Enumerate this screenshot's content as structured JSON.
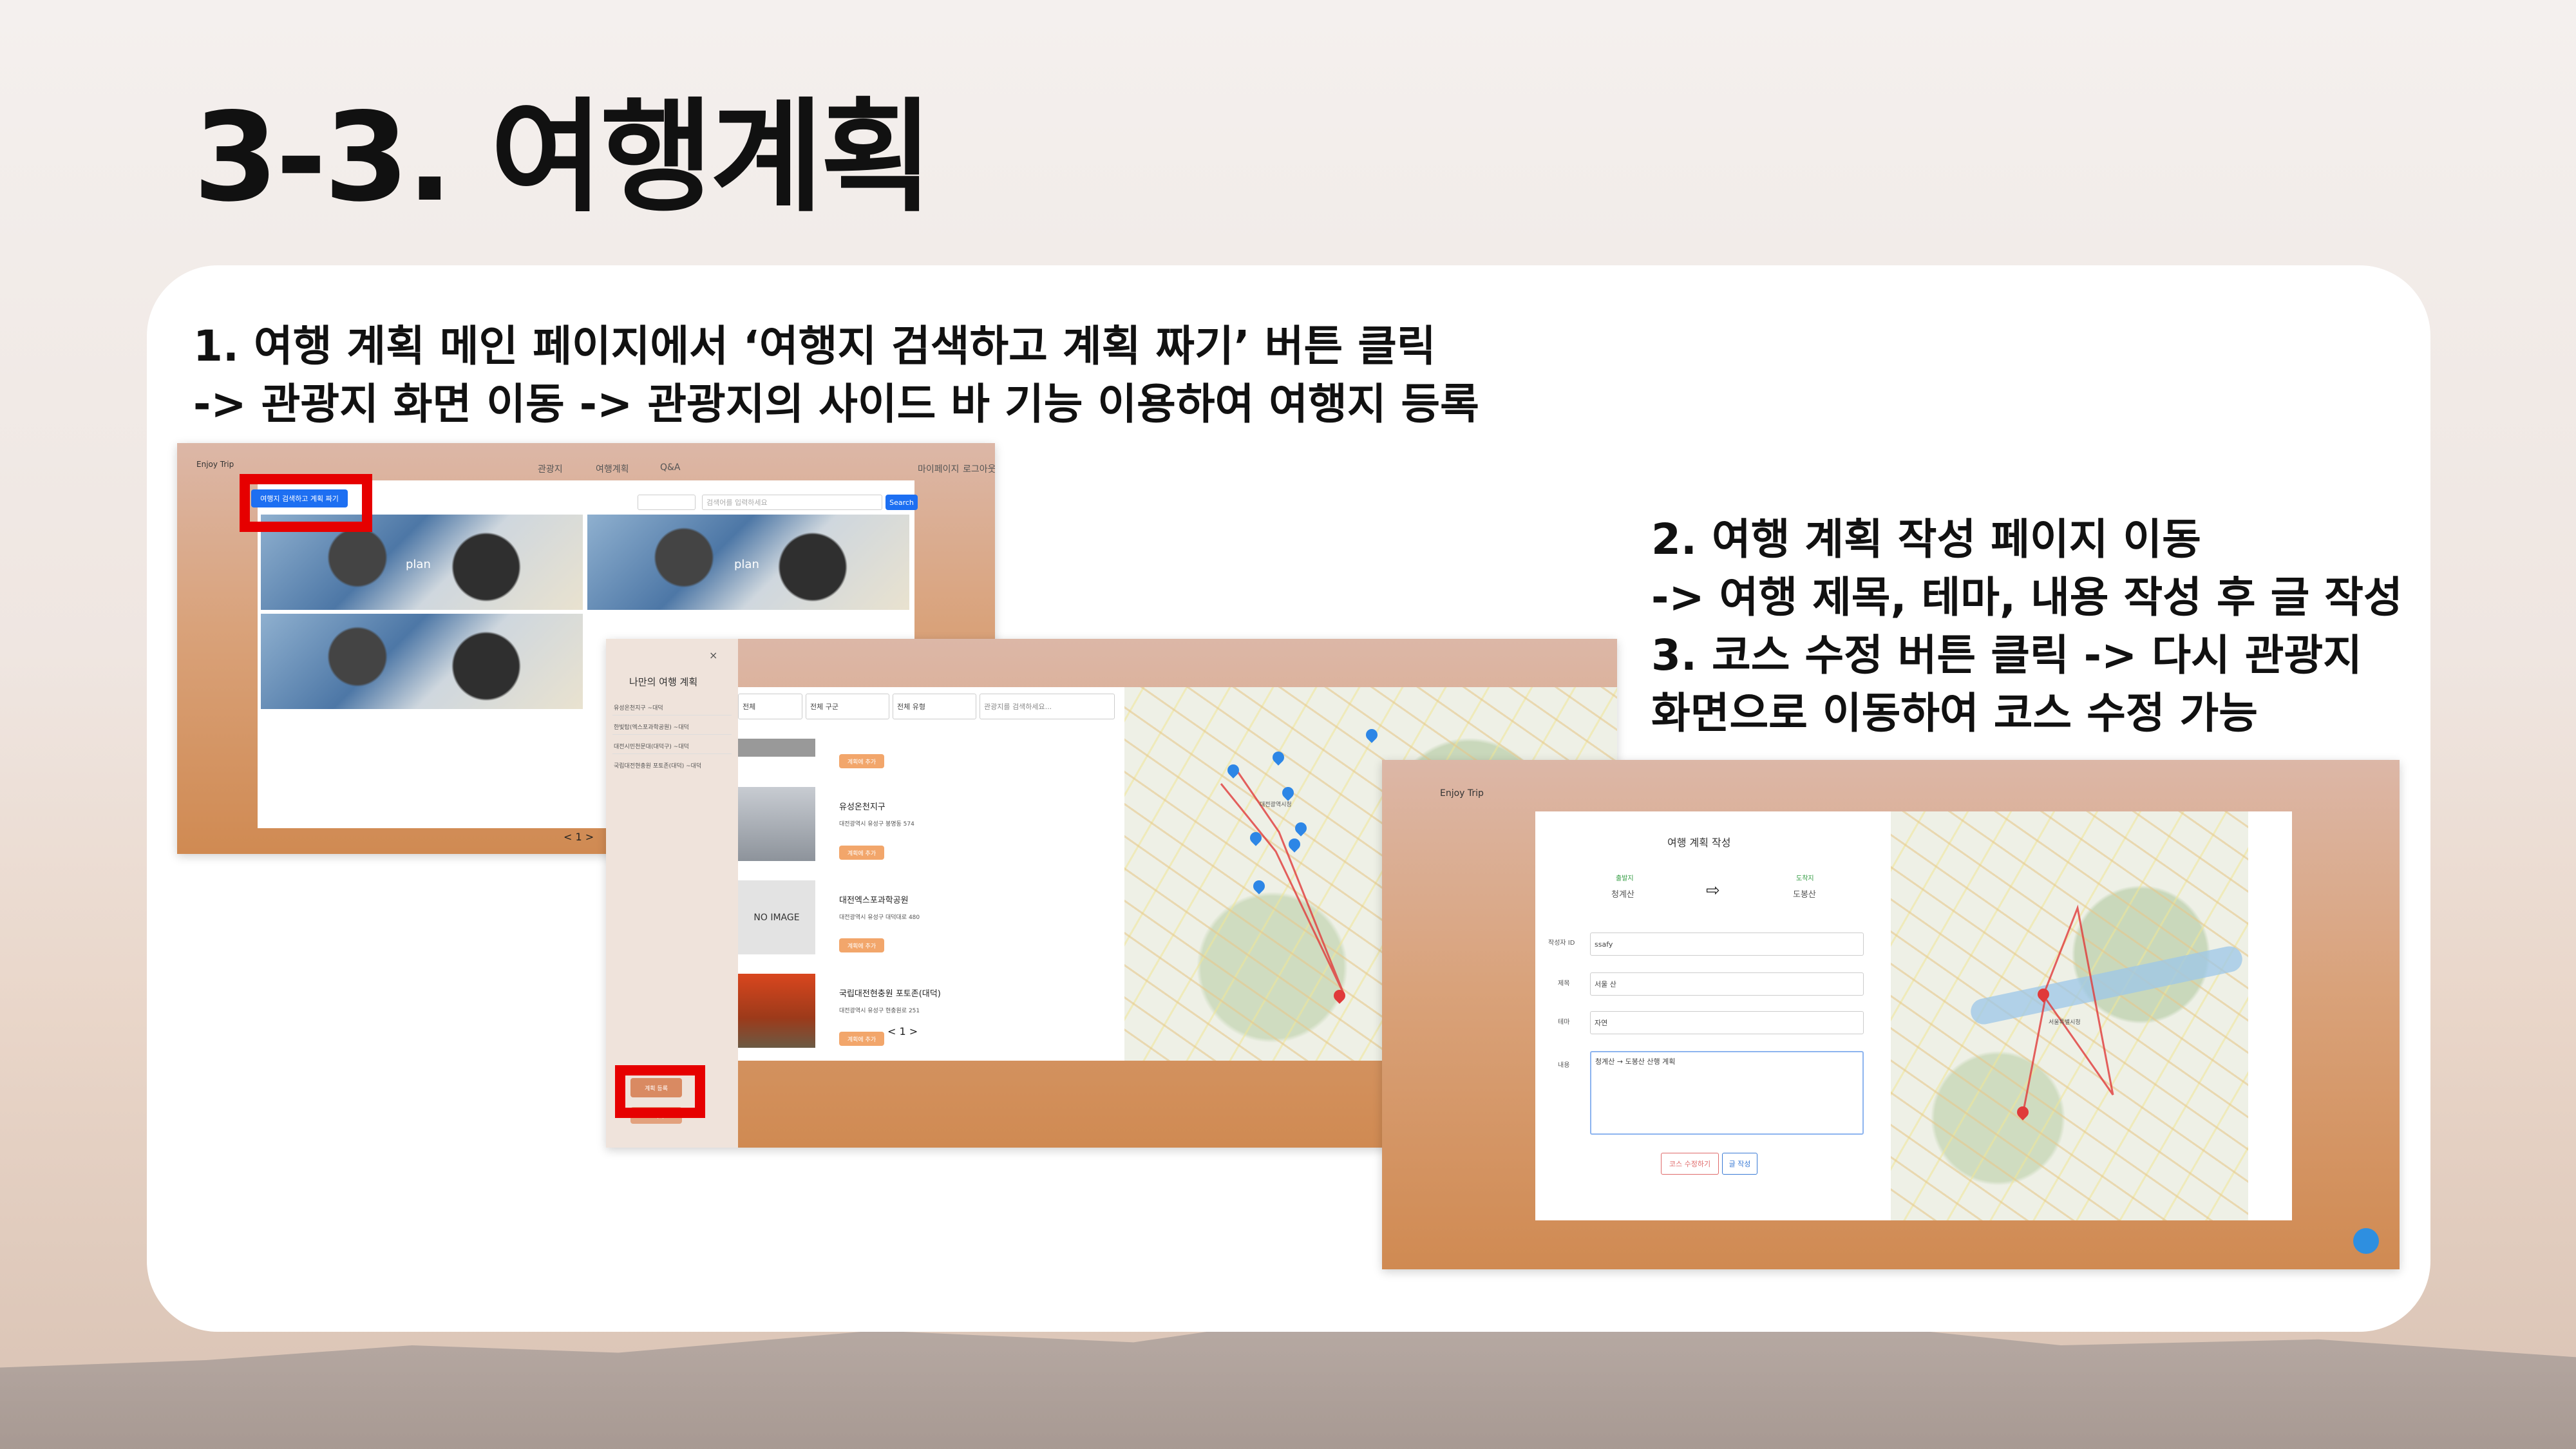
{
  "slide": {
    "title": "3-3. 여행계획",
    "step1_line1": "1. 여행 계획 메인 페이지에서 ‘여행지 검색하고 계획 짜기’ 버튼 클릭",
    "step1_line2": "-> 관광지 화면 이동 -> 관광지의 사이드 바 기능 이용하여 여행지 등록",
    "step2_line1": "2. 여행 계획 작성 페이지 이동",
    "step2_line2": "-> 여행 제목, 테마, 내용 작성 후 글 작성",
    "step3_line1": "3. 코스 수정 버튼 클릭 -> 다시 관광지",
    "step3_line2": "화면으로 이동하여 코스 수정 가능"
  },
  "shot1": {
    "brand": "Enjoy Trip",
    "nav": [
      "관광지",
      "여행계획",
      "Q&A"
    ],
    "user_links": [
      "마이페이지",
      "로그아웃"
    ],
    "plan_button": "여행지 검색하고 계획 짜기",
    "search_placeholder": "검색어를 입력하세요",
    "search_button": "Search",
    "photo_label": "plan",
    "pager": "< 1 >"
  },
  "shot2": {
    "sidebar_title": "나만의 여행 계획",
    "sidebar_items": [
      "유성온천지구 ~대덕",
      "한빛탑(엑스포과학공원) ~대덕",
      "대전시민천문대(대덕구) ~대덕",
      "국립대전현충원 포토존(대덕) ~대덕"
    ],
    "register_button": "계획 등록",
    "cancel_button": "초기화",
    "filters": [
      "전체",
      "전체 구군",
      "전체 유형"
    ],
    "search_placeholder": "관광지를 검색하세요...",
    "results": [
      {
        "name": "유성온천지구",
        "addr": "대전광역시 유성구 봉명동 574",
        "tag": "계획에 추가"
      },
      {
        "name": "대전엑스포과학공원",
        "addr": "대전광역시 유성구 대덕대로 480",
        "tag": "계획에 추가"
      },
      {
        "name": "국립대전현충원 포토존(대덕)",
        "addr": "대전광역시 유성구 현충원로 251",
        "tag": "계획에 추가"
      }
    ],
    "no_image": "NO IMAGE",
    "pager": "< 1 >",
    "map_label": "대전광역시청"
  },
  "shot3": {
    "brand": "Enjoy Trip",
    "form_title": "여행 계획 작성",
    "start_label": "출발지",
    "start_value": "청계산",
    "end_label": "도착지",
    "end_value": "도봉산",
    "fields": [
      {
        "label": "작성자 ID",
        "value": "ssafy"
      },
      {
        "label": "제목",
        "value": "서울 산"
      },
      {
        "label": "테마",
        "value": "자연"
      },
      {
        "label": "내용",
        "value": "청계산 → 도봉산 산행 계획"
      }
    ],
    "edit_course_button": "코스 수정하기",
    "submit_button": "글 작성",
    "map_label": "서울특별시청"
  },
  "colors": {
    "highlight": "#e60000",
    "blue_button": "#1d6ff2",
    "orange_button": "#f2a66b"
  }
}
